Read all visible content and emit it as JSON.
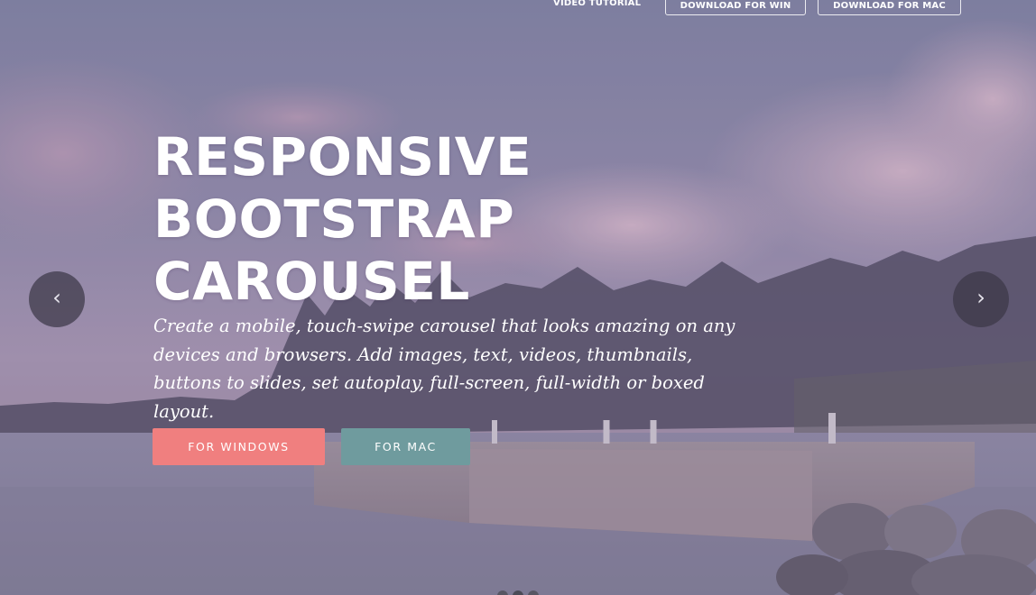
{
  "nav": {
    "video_tutorial": "VIDEO TUTORIAL",
    "download_win": "DOWNLOAD FOR WIN",
    "download_mac": "DOWNLOAD FOR MAC"
  },
  "hero": {
    "title_lines": [
      "RESPONSIVE",
      "BOOTSTRAP",
      "CAROUSEL"
    ],
    "subtitle": "Create a mobile, touch-swipe carousel that looks amazing on any devices and browsers. Add images, text, videos, thumbnails, buttons to slides, set autoplay, full-screen, full-width or boxed layout.",
    "btn_windows": "FOR WINDOWS",
    "btn_mac": "FOR MAC"
  },
  "carousel": {
    "prev_icon": "chevron-left-icon",
    "next_icon": "chevron-right-icon",
    "prev_glyph": "‹",
    "next_glyph": "›",
    "slide_count": 3,
    "active_slide": 2
  },
  "colors": {
    "windows_button": "#f07f7f",
    "mac_button": "#6f9b9e",
    "text": "#ffffff"
  }
}
